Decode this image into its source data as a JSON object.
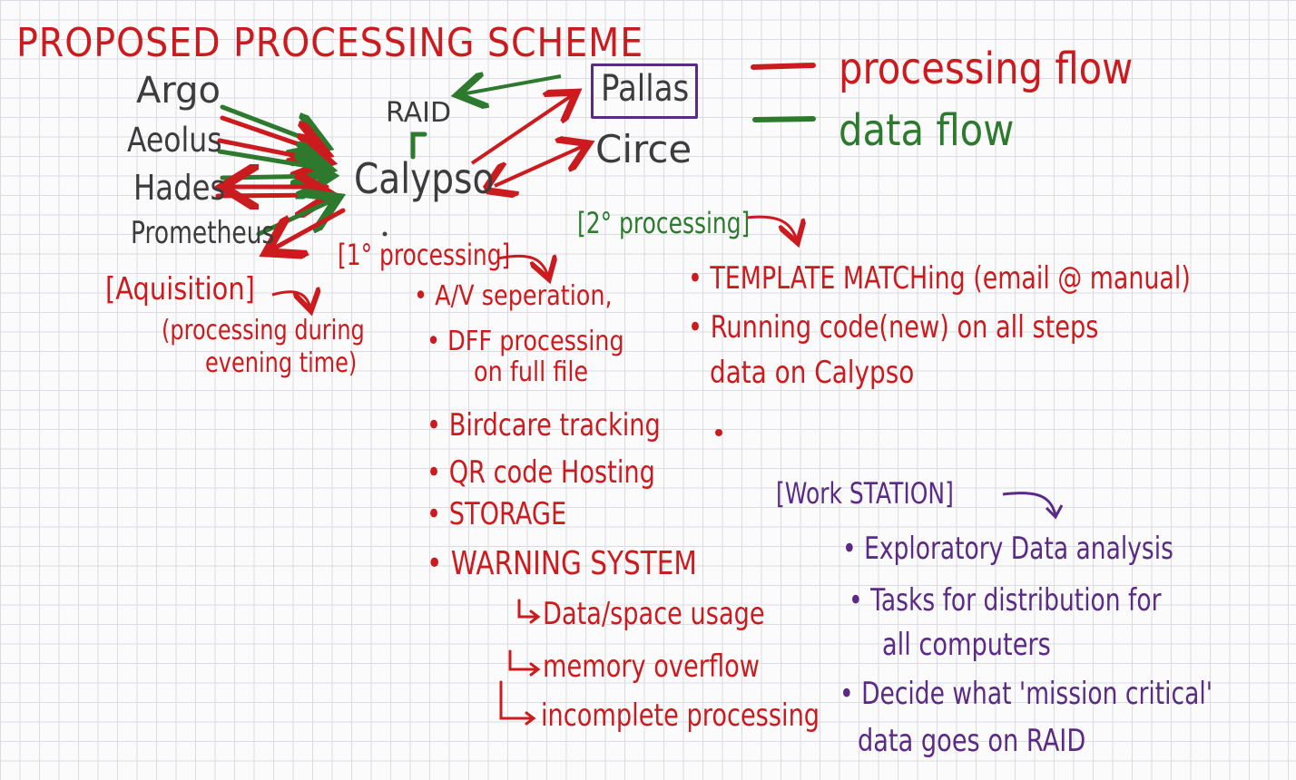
{
  "title": "PROPOSED PROCESSING SCHEME",
  "legend": {
    "processing": "processing flow",
    "data": "data flow",
    "processing_color": "#cc1b1e",
    "data_color": "#2d7a2f"
  },
  "nodes": {
    "argo": "Argo",
    "aeolus": "Aeolus",
    "hades": "Hades",
    "prometheus": "Prometheus",
    "raid": "RAID",
    "calypso": "Calypso",
    "pallas": "Pallas",
    "circe": "Circe"
  },
  "acquisition": {
    "label": "[Aquisition]",
    "note_1": "(processing during",
    "note_2": "evening time)"
  },
  "primary": {
    "label": "[1° processing]",
    "items": [
      "A/V seperation,",
      "DFF processing",
      "on full file",
      "Birdcare tracking",
      "QR code Hosting",
      "STORAGE",
      "WARNING SYSTEM"
    ],
    "warnings": [
      "Data/space usage",
      "memory overflow",
      "incomplete processing"
    ]
  },
  "secondary": {
    "label": "[2° processing]",
    "items": [
      "TEMPLATE MATCHing (email @ manual)",
      "Running code(new) on all steps",
      "data on Calypso"
    ]
  },
  "workstation": {
    "label": "[Work STATION]",
    "items": [
      "Exploratory Data analysis",
      "Tasks for distribution for",
      "all computers",
      "Decide what 'mission critical'",
      "data goes on RAID"
    ]
  },
  "colors": {
    "red": "#cc1b1e",
    "green": "#2d7a2f",
    "gray": "#3c3c3c",
    "purple": "#5b2a86",
    "orange": "#e06a1a",
    "grid": "#d9dde3"
  }
}
